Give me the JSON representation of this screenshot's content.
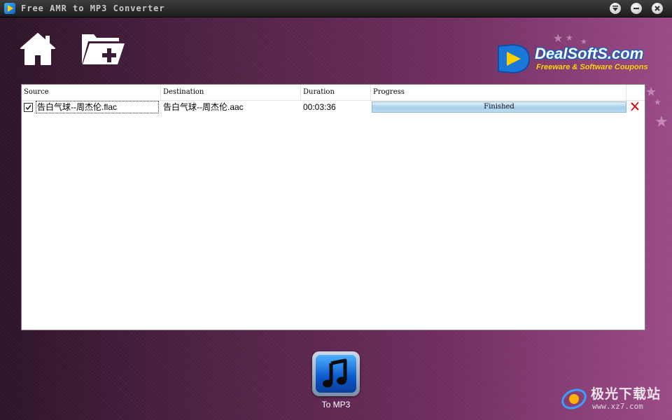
{
  "window": {
    "title": "Free AMR to MP3 Converter",
    "controls": [
      "menu",
      "minimize",
      "close"
    ]
  },
  "toolbar": {
    "home_icon": "home-icon",
    "add_folder_icon": "add-folder-icon"
  },
  "brand": {
    "name": "DealSoftS.com",
    "tagline": "Freeware & Software Coupons"
  },
  "table": {
    "columns": [
      "Source",
      "Destination",
      "Duration",
      "Progress"
    ],
    "rows": [
      {
        "checked": true,
        "source": "告白气球--周杰伦.flac",
        "destination": "告白气球--周杰伦.aac",
        "duration": "00:03:36",
        "progress_label": "Finished",
        "progress": 1.0
      }
    ]
  },
  "convert": {
    "label": "To MP3",
    "icon": "music-note-icon"
  },
  "watermark": {
    "text": "极光下载站",
    "url": "www.xz7.com"
  },
  "colors": {
    "background_dark": "#2d1428",
    "background_light": "#9a4a86",
    "progress_fill": "#a6d0ec",
    "delete_red": "#d10000",
    "brand_blue": "#0d63c7",
    "brand_yellow": "#ffd52a"
  }
}
